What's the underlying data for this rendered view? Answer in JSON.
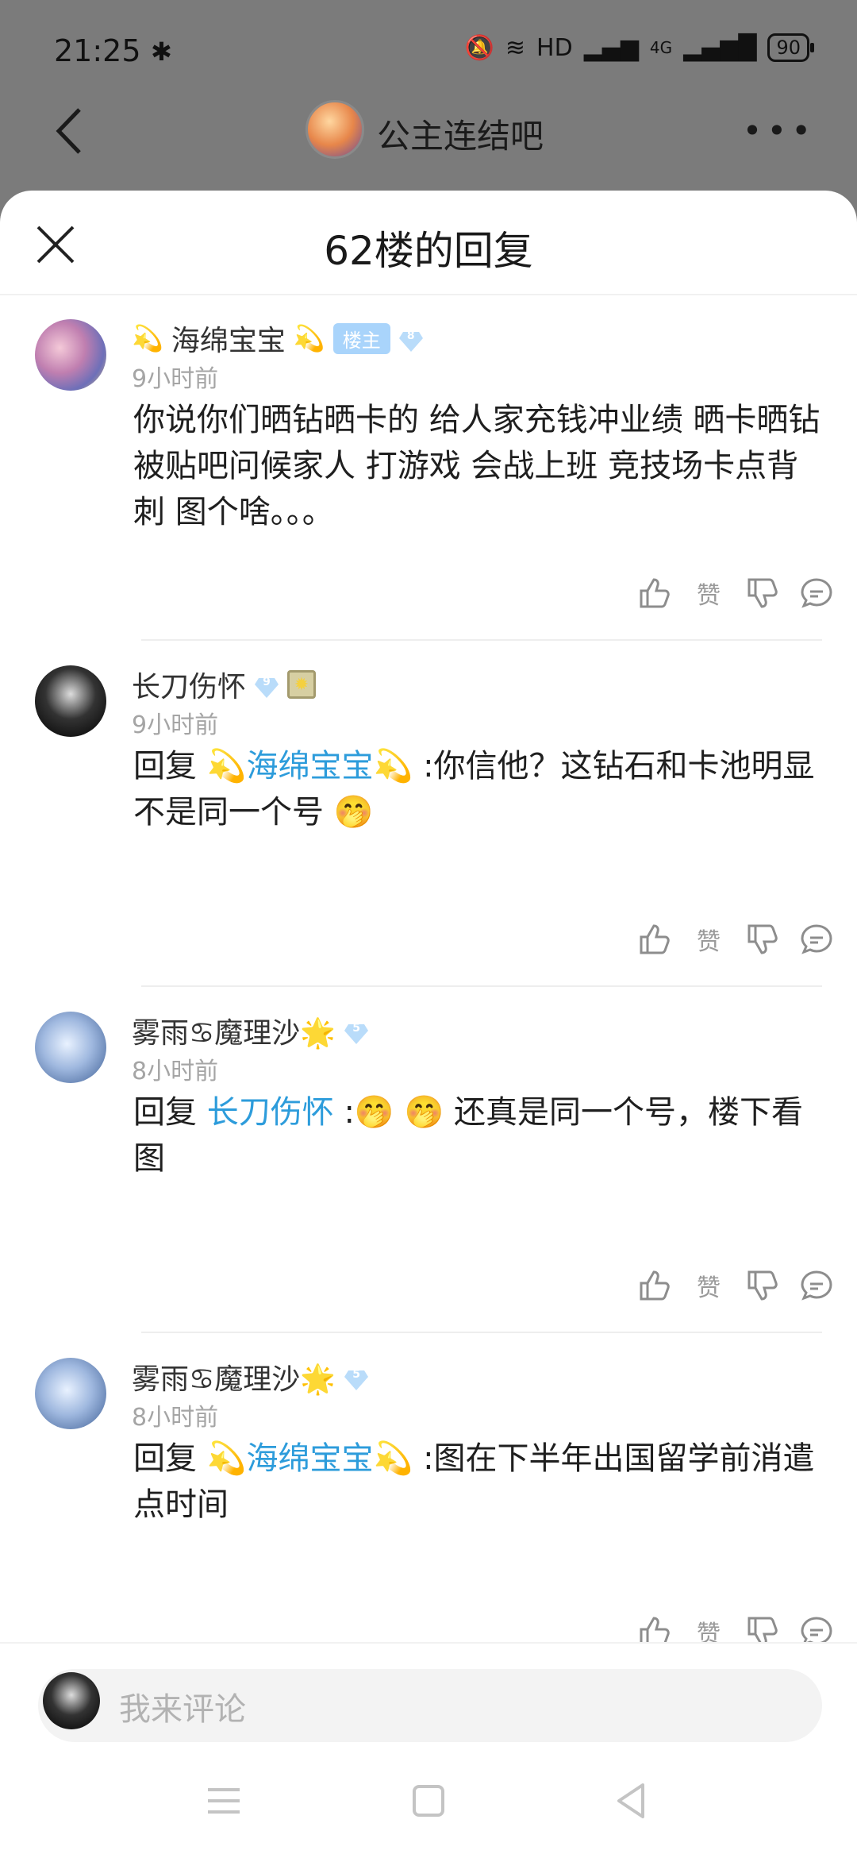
{
  "status": {
    "time": "21:25",
    "hd": "HD",
    "net": "4G",
    "battery": "90"
  },
  "topbar": {
    "forum_name": "公主连结吧"
  },
  "sheet": {
    "title": "62楼的回复"
  },
  "replies": [
    {
      "name": "海绵宝宝",
      "host_badge": "楼主",
      "level": "8",
      "time": "9小时前",
      "text": "你说你们晒钻晒卡的 给人家充钱冲业绩 晒卡晒钻被贴吧问候家人 打游戏 会战上班 竞技场卡点背刺 图个啥。。。",
      "like_label": "赞"
    },
    {
      "name": "长刀伤怀",
      "level": "9",
      "time": "9小时前",
      "reply_prefix": "回复",
      "mention": "海绵宝宝",
      "text": ":你信他？这钻石和卡池明显不是同一个号",
      "like_label": "赞"
    },
    {
      "name_a": "雾雨",
      "name_b": "魔理沙",
      "level": "5",
      "time": "8小时前",
      "reply_prefix": "回复",
      "mention": "长刀伤怀",
      "text": "还真是同一个号，楼下看图",
      "like_label": "赞"
    },
    {
      "name_a": "雾雨",
      "name_b": "魔理沙",
      "level": "5",
      "time": "8小时前",
      "reply_prefix": "回复",
      "mention": "海绵宝宝",
      "text": ":图在下半年出国留学前消遣点时间",
      "like_label": "赞"
    }
  ],
  "input": {
    "placeholder": "我来评论"
  }
}
